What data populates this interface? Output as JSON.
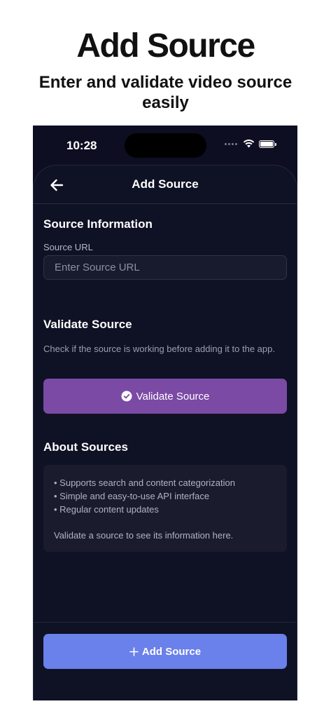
{
  "promo": {
    "title": "Add Source",
    "subtitle": "Enter and validate video source easily"
  },
  "status_bar": {
    "time": "10:28",
    "icons": [
      "signal-dots-icon",
      "wifi-icon",
      "battery-icon"
    ]
  },
  "nav": {
    "title": "Add Source",
    "back_icon": "arrow-left-icon"
  },
  "source_info": {
    "section_title": "Source Information",
    "field_label": "Source URL",
    "url_value": "",
    "url_placeholder": "Enter Source URL"
  },
  "validate": {
    "section_title": "Validate Source",
    "description": "Check if the source is working before adding it to the app.",
    "button_label": "Validate Source",
    "button_icon": "check-circle-icon",
    "button_color": "#7a4aa5"
  },
  "about": {
    "section_title": "About Sources",
    "bullets": [
      "• Supports search and content categorization",
      "• Simple and easy-to-use API interface",
      "• Regular content updates"
    ],
    "note": "Validate a source to see its information here."
  },
  "footer": {
    "add_button_label": "Add Source",
    "add_button_icon": "plus-icon",
    "button_color": "#6a80ea"
  },
  "theme": {
    "background": "#0f1124",
    "text": "#ffffff"
  }
}
